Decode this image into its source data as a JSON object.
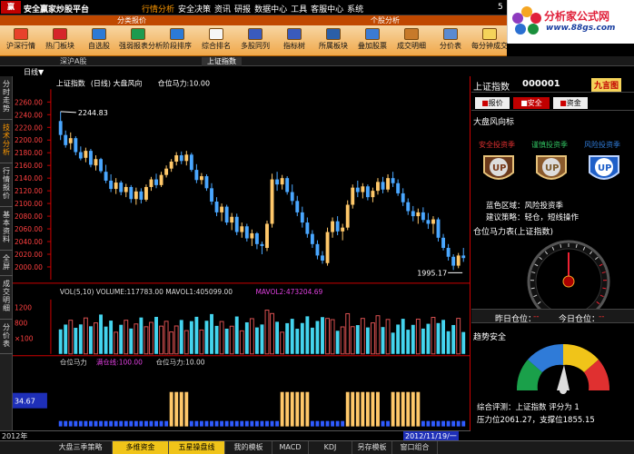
{
  "menubar": {
    "title": "安全赢家炒股平台",
    "items": [
      "行情分析",
      "安全决策",
      "资讯",
      "研报",
      "数据中心",
      "工具",
      "客服中心",
      "系统"
    ],
    "active_index": 0,
    "window_number": "5"
  },
  "brand": {
    "name": "分析家公式网",
    "url": "www.88gs.com"
  },
  "toolbar": {
    "group_headers": [
      "分类报价",
      "个股分析"
    ],
    "buttons": [
      {
        "label": "沪深行情",
        "icon": "quote-icon",
        "color": "#e8412b"
      },
      {
        "label": "热门板块",
        "icon": "sector-icon",
        "color": "#d6252a"
      },
      {
        "label": "自选股",
        "icon": "favorites-icon",
        "color": "#2c7ad6"
      },
      {
        "label": "强弱报表分析",
        "icon": "strength-report-icon",
        "color": "#1d9b4f"
      },
      {
        "label": "阶段排序",
        "icon": "stage-sort-icon",
        "color": "#2c7ad6"
      },
      {
        "label": "综合排名",
        "icon": "ranking-icon",
        "color": "#f6f6f6"
      },
      {
        "label": "多股同列",
        "icon": "multi-stock-icon",
        "color": "#3a5bbd"
      },
      {
        "label": "指标树",
        "icon": "indicator-tree-icon",
        "color": "#3a5bbd"
      },
      {
        "label": "所属板块",
        "icon": "belonging-sector-icon",
        "color": "#2b5fa8"
      },
      {
        "label": "叠加股票",
        "icon": "overlay-icon",
        "color": "#3b7bd4"
      },
      {
        "label": "成交明细",
        "icon": "trade-detail-icon",
        "color": "#c77a2a"
      },
      {
        "label": "分价表",
        "icon": "price-table-icon",
        "color": "#5a8ad0"
      },
      {
        "label": "每分钟成交",
        "icon": "per-minute-icon",
        "color": "#f5d35a"
      }
    ]
  },
  "tabs": [
    "深沪A股",
    "上证指数"
  ],
  "sidebar": [
    "分时走势",
    "技术分析",
    "行情报价",
    "基本资料",
    "全屏",
    "成交明细",
    "分价表"
  ],
  "sidebar_active": 1,
  "chart_header": {
    "period": "日线▼",
    "title": "上证指数",
    "subtitle": "(日线) 大盘风向",
    "indicator": "仓位马力:10.00"
  },
  "volume_header": {
    "text": "VOL(5,10)  VOLUME:117783.00  MAVOL1:405099.00",
    "mavol2": "MAVOL2:473204.69"
  },
  "power_header": {
    "label": "仓位马力",
    "text1": "满仓线:100.00",
    "text2": "仓位马力:10.00"
  },
  "power_value": "34.67",
  "date_left": "2012年",
  "date_cursor": "2012/11/19/一",
  "chart_data": [
    {
      "type": "candlestick",
      "title": "上证指数",
      "ylim": [
        1980,
        2280
      ],
      "y_ticks": [
        2260,
        2240,
        2220,
        2200,
        2180,
        2160,
        2140,
        2120,
        2100,
        2080,
        2060,
        2040,
        2020,
        2000
      ],
      "annotations": [
        {
          "text": "2244.83"
        },
        {
          "text": "1995.17"
        }
      ],
      "up_color": "#ffc86a",
      "down_color": "#4aa7ff",
      "candles": [
        [
          2230,
          2244.83,
          2200,
          2208
        ],
        [
          2208,
          2215,
          2188,
          2192
        ],
        [
          2195,
          2212,
          2185,
          2203
        ],
        [
          2203,
          2206,
          2176,
          2181
        ],
        [
          2181,
          2190,
          2168,
          2171
        ],
        [
          2172,
          2188,
          2165,
          2183
        ],
        [
          2183,
          2186,
          2157,
          2161
        ],
        [
          2160,
          2176,
          2152,
          2170
        ],
        [
          2170,
          2172,
          2148,
          2151
        ],
        [
          2150,
          2161,
          2132,
          2136
        ],
        [
          2136,
          2146,
          2118,
          2123
        ],
        [
          2123,
          2140,
          2115,
          2133
        ],
        [
          2133,
          2136,
          2113,
          2118
        ],
        [
          2118,
          2131,
          2110,
          2126
        ],
        [
          2126,
          2129,
          2101,
          2107
        ],
        [
          2107,
          2125,
          2098,
          2119
        ],
        [
          2119,
          2124,
          2100,
          2106
        ],
        [
          2106,
          2130,
          2103,
          2126
        ],
        [
          2126,
          2142,
          2120,
          2138
        ],
        [
          2138,
          2147,
          2124,
          2129
        ],
        [
          2129,
          2150,
          2126,
          2145
        ],
        [
          2145,
          2160,
          2141,
          2155
        ],
        [
          2155,
          2170,
          2150,
          2166
        ],
        [
          2166,
          2181,
          2160,
          2176
        ],
        [
          2176,
          2182,
          2162,
          2167
        ],
        [
          2167,
          2183,
          2160,
          2177
        ],
        [
          2177,
          2180,
          2150,
          2153
        ],
        [
          2153,
          2162,
          2132,
          2137
        ],
        [
          2137,
          2148,
          2130,
          2143
        ],
        [
          2143,
          2146,
          2120,
          2124
        ],
        [
          2124,
          2132,
          2098,
          2103
        ],
        [
          2103,
          2110,
          2080,
          2086
        ],
        [
          2086,
          2100,
          2072,
          2095
        ],
        [
          2095,
          2098,
          2066,
          2070
        ],
        [
          2070,
          2085,
          2058,
          2079
        ],
        [
          2079,
          2084,
          2050,
          2055
        ],
        [
          2055,
          2070,
          2046,
          2064
        ],
        [
          2064,
          2068,
          2040,
          2045
        ],
        [
          2045,
          2059,
          2033,
          2053
        ],
        [
          2053,
          2055,
          2028,
          2036
        ],
        [
          2036,
          2040,
          2020,
          2033
        ],
        [
          2030,
          2073,
          2025,
          2068
        ],
        [
          2068,
          2147,
          2062,
          2138
        ],
        [
          2138,
          2150,
          2120,
          2130
        ],
        [
          2130,
          2145,
          2122,
          2140
        ],
        [
          2140,
          2143,
          2114,
          2118
        ],
        [
          2118,
          2130,
          2098,
          2104
        ],
        [
          2104,
          2112,
          2080,
          2086
        ],
        [
          2086,
          2095,
          2062,
          2070
        ],
        [
          2070,
          2078,
          2046,
          2052
        ],
        [
          2052,
          2058,
          2030,
          2036
        ],
        [
          2036,
          2042,
          2012,
          2018
        ],
        [
          2018,
          2025,
          2005,
          2010
        ],
        [
          2006,
          2062,
          2002,
          2055
        ],
        [
          2055,
          2078,
          2046,
          2072
        ],
        [
          2072,
          2080,
          2050,
          2056
        ],
        [
          2056,
          2068,
          2042,
          2062
        ],
        [
          2062,
          2105,
          2058,
          2098
        ],
        [
          2098,
          2130,
          2092,
          2125
        ],
        [
          2125,
          2136,
          2110,
          2118
        ],
        [
          2118,
          2132,
          2108,
          2127
        ],
        [
          2127,
          2130,
          2105,
          2110
        ],
        [
          2110,
          2125,
          2102,
          2120
        ],
        [
          2120,
          2140,
          2114,
          2134
        ],
        [
          2134,
          2142,
          2116,
          2122
        ],
        [
          2122,
          2146,
          2118,
          2140
        ],
        [
          2140,
          2150,
          2126,
          2132
        ],
        [
          2132,
          2138,
          2112,
          2116
        ],
        [
          2116,
          2124,
          2096,
          2102
        ],
        [
          2102,
          2108,
          2082,
          2088
        ],
        [
          2088,
          2096,
          2072,
          2080
        ],
        [
          2080,
          2092,
          2068,
          2086
        ],
        [
          2086,
          2094,
          2070,
          2074
        ],
        [
          2074,
          2085,
          2060,
          2068
        ],
        [
          2068,
          2080,
          2052,
          2075
        ],
        [
          2075,
          2078,
          2040,
          2046
        ],
        [
          2046,
          2052,
          2026,
          2030
        ],
        [
          2030,
          2036,
          2010,
          2016
        ],
        [
          2016,
          2020,
          1995.17,
          2002
        ],
        [
          2002,
          2022,
          1998,
          2018
        ],
        [
          2018,
          2030,
          2008,
          2014
        ]
      ]
    },
    {
      "type": "bar",
      "title": "VOL(5,10)",
      "ylim": [
        0,
        1400
      ],
      "y_ticks": [
        1200,
        800,
        400
      ],
      "y_tick_labels": [
        "1200",
        "800",
        "×100"
      ],
      "up_color": "#d85050",
      "down_color": "#44d4ee"
    },
    {
      "type": "bar",
      "title": "仓位马力",
      "ylim": [
        0,
        100
      ],
      "y_ticks": [
        34.67
      ],
      "values_note_levels": [
        10,
        100
      ]
    }
  ],
  "right_panel": {
    "index_name": "上证指数",
    "index_code": "000001",
    "badge": "九言图",
    "report_buttons": [
      "报价",
      "安全",
      "资金"
    ],
    "wind_title": "大盘风向标",
    "season_labels": [
      "安全投资季",
      "谨慎投资季",
      "风险投资季"
    ],
    "season_colors": [
      "#e03030",
      "#30c060",
      "#2f7bd8"
    ],
    "zone": "蓝色区域：风险投资季",
    "strategy": "建议策略：轻仓，短线操作",
    "position_title": "仓位马力表(上证指数)",
    "yesterday": "昨日仓位：",
    "today": "今日仓位：",
    "yesterday_value": "--",
    "today_value": "--",
    "trend_title": "趋势安全",
    "eval": "综合评测：上证指数  评分为      1",
    "pressure": "压力位2061.27，支撑位1855.15"
  },
  "bottom_tabs": [
    "大盘三季策略",
    "多维资金",
    "五星操盘线",
    "我的模板",
    "MACD",
    "KDJ",
    "另存模板",
    "窗口组合"
  ],
  "bottom_active": [
    1,
    2
  ]
}
